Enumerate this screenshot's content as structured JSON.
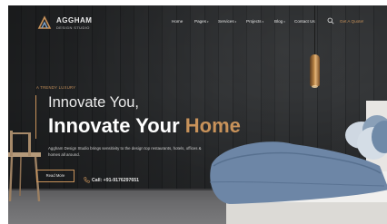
{
  "brand": {
    "name": "AGGHAM",
    "subtitle": "DESIGN STUDIO"
  },
  "nav": {
    "items": [
      {
        "label": "Home",
        "dropdown": false
      },
      {
        "label": "Pages",
        "dropdown": true
      },
      {
        "label": "Services",
        "dropdown": true
      },
      {
        "label": "Projects",
        "dropdown": true
      },
      {
        "label": "Blog",
        "dropdown": true
      },
      {
        "label": "Contact Us",
        "dropdown": false
      }
    ],
    "search_icon": "search-icon",
    "cta_label": "Get A Quote!"
  },
  "hero": {
    "tagline": "A TRENDY LUXURY",
    "heading_line1": "Innovate You,",
    "heading_line2_main": "Innovate Your ",
    "heading_line2_accent": "Home",
    "description": "Aggham Design Studio brings sensitivity to the design top restaurants, hotels, offices & homes all around.",
    "read_more_label": "Read More",
    "call_label": "Call: +91-9176297651"
  },
  "colors": {
    "accent": "#c8925a",
    "background": "#2b2d2f",
    "text": "#ffffff"
  }
}
